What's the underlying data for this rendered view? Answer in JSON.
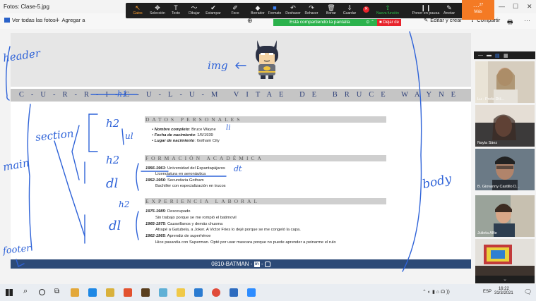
{
  "window": {
    "title": "Fotos: Clase-5.jpg"
  },
  "photos_toolbar": {
    "view_all": "Ver todas las fotos",
    "add": "Agregar a",
    "edit": "Editar y crear",
    "share": "Compartir"
  },
  "zoom_toolbar": {
    "tools": [
      {
        "label": "Gatos",
        "icon": "pointer-icon"
      },
      {
        "label": "Selección",
        "icon": "move-icon"
      },
      {
        "label": "Texto",
        "icon": "text-icon"
      },
      {
        "label": "Dibujar",
        "icon": "draw-icon"
      },
      {
        "label": "Estampar",
        "icon": "stamp-icon"
      },
      {
        "label": "Foco",
        "icon": "spotlight-icon"
      },
      {
        "label": "Borrador",
        "icon": "eraser-icon"
      },
      {
        "label": "Formato",
        "icon": "format-icon"
      },
      {
        "label": "Deshacer",
        "icon": "undo-icon"
      },
      {
        "label": "Rehacer",
        "icon": "redo-icon"
      },
      {
        "label": "Borrar",
        "icon": "trash-icon"
      },
      {
        "label": "Guardar",
        "icon": "save-icon"
      }
    ],
    "new_feature": "Nueva función",
    "pause": "Poner en pausa",
    "annotate": "Anotar",
    "more": "Más",
    "more_badge": "27",
    "sharing_status": "Está compartiendo la pantalla",
    "stop": "Dejar de"
  },
  "document": {
    "cv_title": "C-U-R-R-I-C-U-L-U-M   VITAE   DE   BRUCE   WAYNE",
    "sections": {
      "personal": "DATOS PERSONALES",
      "academic": "FORMACIÓN ACADÉMICA",
      "work": "EXPERIENCIA LABORAL"
    },
    "personal_items": [
      {
        "label": "Nombre completo",
        "value": "Bruce Wayne"
      },
      {
        "label": "Fecha de nacimiento",
        "value": "1/5/1939"
      },
      {
        "label": "Lugar de nacimiento",
        "value": "Gotham City"
      }
    ],
    "academic_items": [
      {
        "dates": "1956-1961",
        "place": "Universidad del Espantapájaros",
        "desc": "Licenciatura en aeronáutica"
      },
      {
        "dates": "1952-1956",
        "place": "Secundaria Gotham",
        "desc": "Bachiller con especialización en trucos"
      }
    ],
    "work_items": [
      {
        "dates": "1975-1985",
        "place": "Desocupado",
        "desc": "Sin trabajo porque se me rompió el batimovil"
      },
      {
        "dates": "1965-1975",
        "place": "Cazavillanos y demás chusma",
        "desc": "Atrapé a Gatubela, a Joker. A Victor Fries lo dejé porque se me congeló la capa."
      },
      {
        "dates": "1962-1965",
        "place": "Aprendiz de superhéroe",
        "desc": "Hice pasantía con Superman. Opté por usar mascara porque no puede aprender a peinarme el rulo"
      }
    ],
    "footer": "0810-BATMAN -"
  },
  "annotations": {
    "header": "header",
    "img": "img",
    "h1": "h1",
    "h2a": "h2",
    "ul": "ul",
    "li": "li",
    "h2b": "h2",
    "dl1": "dl",
    "dt": "dt",
    "h2c": "h2",
    "dl2": "dl",
    "section": "section",
    "main": "main",
    "body": "body",
    "footer": "footer"
  },
  "participants": [
    {
      "name": "Lu - Profe DH..."
    },
    {
      "name": "Nayla Sáez"
    },
    {
      "name": "B. Giovanny Castillo D..."
    },
    {
      "name": "Julieta Alfie"
    }
  ],
  "taskbar": {
    "time": "16:22",
    "date": "31/3/2021",
    "lang": "ESP"
  },
  "colors": {
    "zoom_accent": "#ff9f2e",
    "share_green": "#2bb24c",
    "stop_red": "#e8242c",
    "footer_blue": "#2c4a77",
    "ink": "#2f63d8"
  }
}
